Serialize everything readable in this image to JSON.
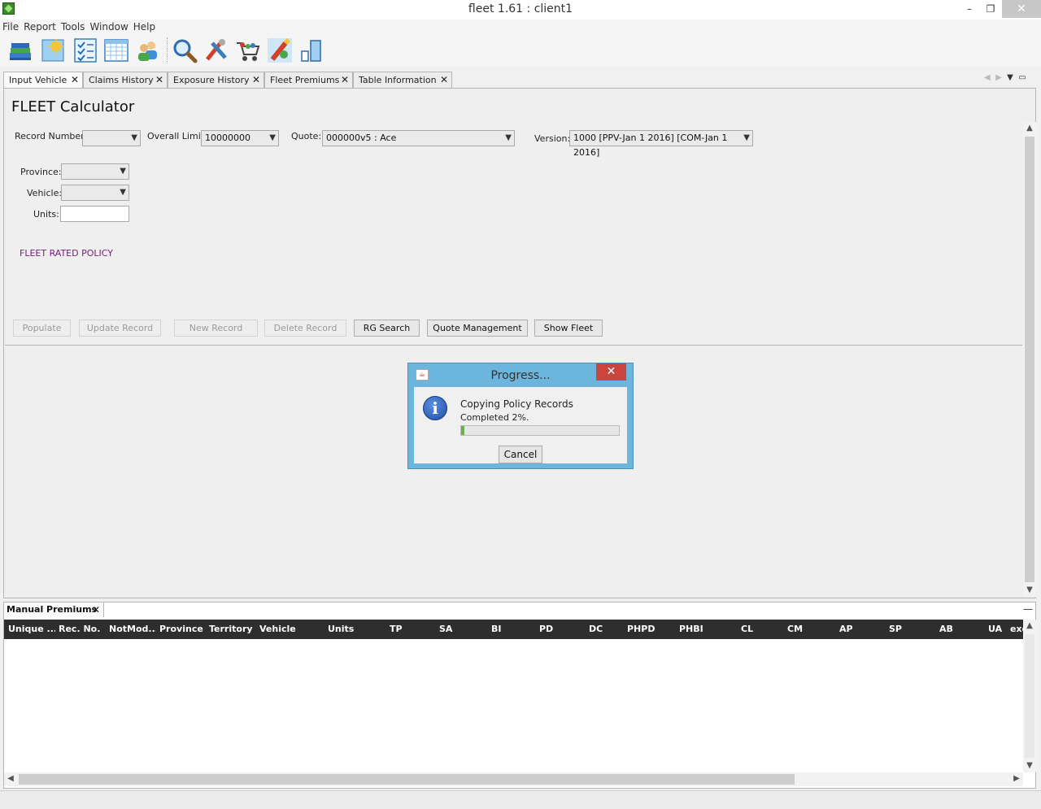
{
  "window": {
    "title": "fleet 1.61 : client1",
    "minimize": "–",
    "restore": "❐",
    "close": "✕"
  },
  "menubar": [
    "File",
    "Report",
    "Tools",
    "Window",
    "Help"
  ],
  "toolbar_icons": [
    "books-icon",
    "new-document-icon",
    "checklist-icon",
    "spreadsheet-icon",
    "users-icon",
    "search-icon",
    "tools-icon",
    "shopping-cart-icon",
    "pencil-tag-icon",
    "bar-chart-icon"
  ],
  "tabs": [
    {
      "label": "Input Vehicle",
      "active": true
    },
    {
      "label": "Claims History",
      "active": false
    },
    {
      "label": "Exposure History",
      "active": false
    },
    {
      "label": "Fleet Premiums",
      "active": false
    },
    {
      "label": "Table Information",
      "active": false
    }
  ],
  "tab_close": "✕",
  "tab_nav": {
    "left": "◀",
    "right": "▶",
    "menu": "▼",
    "maximize": "▭"
  },
  "main": {
    "title": "FLEET Calculator",
    "record_number": {
      "label": "Record Number:",
      "value": ""
    },
    "overall_limit": {
      "label": "Overall Limit:",
      "value": "10000000"
    },
    "quote": {
      "label": "Quote:",
      "value": "000000v5 : Ace"
    },
    "version": {
      "label": "Version:",
      "value": "1000 [PPV-Jan 1 2016] [COM-Jan 1 2016]"
    },
    "province": {
      "label": "Province:",
      "value": ""
    },
    "vehicle": {
      "label": "Vehicle:",
      "value": ""
    },
    "units": {
      "label": "Units:",
      "value": ""
    },
    "policy_status": "FLEET RATED POLICY",
    "buttons": [
      {
        "label": "Populate",
        "enabled": false
      },
      {
        "label": "Update Record",
        "enabled": false
      },
      {
        "label": "New Record",
        "enabled": false
      },
      {
        "label": "Delete Record",
        "enabled": false
      },
      {
        "label": "RG Search",
        "enabled": true
      },
      {
        "label": "Quote Management",
        "enabled": true
      },
      {
        "label": "Show Fleet",
        "enabled": true
      }
    ]
  },
  "dialog": {
    "title": "Progress...",
    "message": "Copying Policy Records",
    "status": "Completed 2%.",
    "progress": 0.02,
    "cancel": "Cancel",
    "close": "✕",
    "icon_letter": "i"
  },
  "bottom_panel": {
    "tab_label": "Manual Premiums",
    "minimize": "—",
    "columns": [
      "Unique ...",
      "Rec. No.",
      "NotMod...",
      "Province",
      "Territory",
      "Vehicle",
      "Units",
      "TP",
      "SA",
      "BI",
      "PD",
      "DC",
      "PHPD",
      "PHBI",
      "CL",
      "CM",
      "AP",
      "SP",
      "AB",
      "UA",
      "exc"
    ],
    "rows": []
  },
  "scroll_arrows": {
    "up": "▲",
    "down": "▼",
    "left": "◀",
    "right": "▶"
  },
  "colors": {
    "accent": "#6cb5dc",
    "header_bg": "#2e2e2e",
    "status_purple": "#7a1a7a",
    "close_red": "#c9453e"
  }
}
